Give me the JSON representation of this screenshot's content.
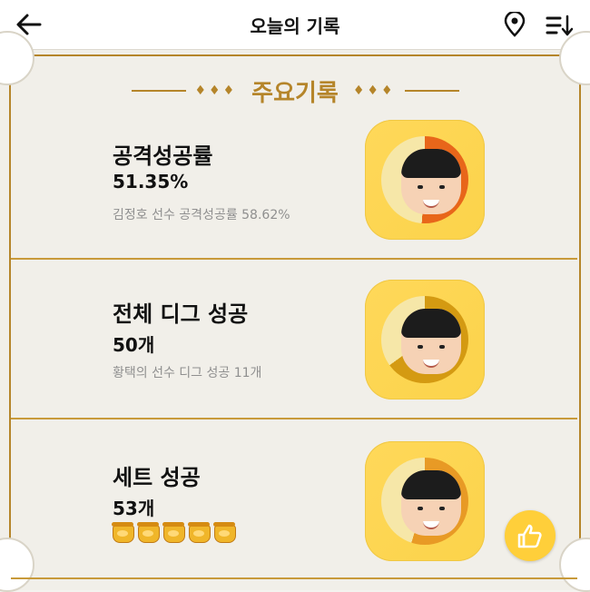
{
  "header": {
    "title": "오늘의 기록",
    "icons": [
      "back-arrow-icon",
      "location-pin-icon",
      "sort-icon"
    ]
  },
  "banner": {
    "heading": "주요기록",
    "ornament_left": "♦♦♦",
    "ornament_right": "♦♦♦"
  },
  "records": [
    {
      "label": "공격성공률",
      "value": "51.35%",
      "sub": "김정호 선수 공격성공률 58.62%",
      "ring_color": "#e8661a",
      "progress_fraction": 0.51
    },
    {
      "label": "전체 디그 성공",
      "value": "50개",
      "sub": "황택의 선수 디그 성공 11개",
      "ring_color": "#d49a12",
      "progress_fraction": 0.65
    },
    {
      "label": "세트 성공",
      "value": "53개",
      "honey_count": 5,
      "ring_color": "#e89a25",
      "progress_fraction": 0.55
    }
  ],
  "colors": {
    "accent": "#b5852a",
    "tile": "#ffd85a",
    "fab": "#ffcf3a"
  },
  "fab": {
    "icon": "thumbs-up-icon"
  }
}
